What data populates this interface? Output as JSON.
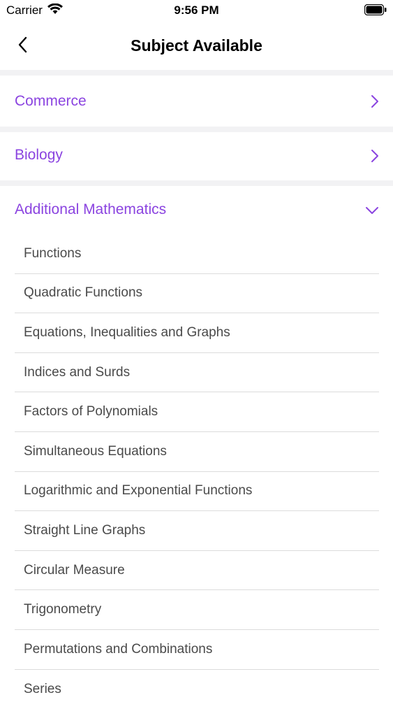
{
  "status_bar": {
    "carrier": "Carrier",
    "time": "9:56 PM"
  },
  "nav": {
    "title": "Subject Available",
    "back_icon": "chevron-left-icon"
  },
  "colors": {
    "accent": "#8b44e0",
    "topic_text": "#4a4a4a",
    "divider": "#dcdcdc",
    "section_separator": "#f2f2f4"
  },
  "subjects": [
    {
      "label": "Commerce",
      "icon": "chevron-right-icon",
      "expanded": false
    },
    {
      "label": "Biology",
      "icon": "chevron-right-icon",
      "expanded": false
    },
    {
      "label": "Additional Mathematics",
      "icon": "chevron-down-icon",
      "expanded": true
    }
  ],
  "topics": [
    "Functions",
    "Quadratic Functions",
    "Equations, Inequalities and Graphs",
    "Indices and Surds",
    "Factors of Polynomials",
    "Simultaneous Equations",
    "Logarithmic and Exponential Functions",
    "Straight Line Graphs",
    "Circular Measure",
    "Trigonometry",
    "Permutations and Combinations",
    "Series"
  ]
}
